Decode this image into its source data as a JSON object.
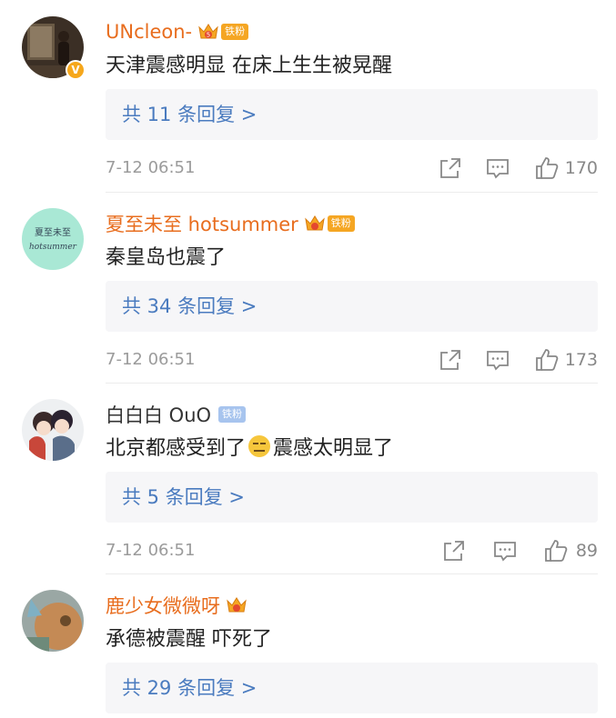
{
  "comments": [
    {
      "username": "UNcleon-",
      "crown_level": "5",
      "fan_badge": "铁粉",
      "verified_badge": "V",
      "text": "天津震感明显 在床上生生被晃醒",
      "replies": "共 11 条回复 >",
      "time": "7-12 06:51",
      "likes": "170",
      "name_color": "#e86d1e"
    },
    {
      "username": "夏至未至 hotsummer",
      "crown_level": "",
      "fan_badge": "铁粉",
      "avatar_text_1": "夏至未至",
      "avatar_text_2": "hotsummer",
      "text": "秦皇岛也震了",
      "replies": "共 34 条回复 >",
      "time": "7-12 06:51",
      "likes": "173",
      "name_color": "#e86d1e"
    },
    {
      "username": "白白白 OuO",
      "fan_badge": "铁粉",
      "text_before": "北京都感受到了",
      "emoji": "expressionless-face",
      "text_after": "震感太明显了",
      "replies": "共 5 条回复 >",
      "time": "7-12 06:51",
      "likes": "89",
      "name_color": "#333333"
    },
    {
      "username": "鹿少女微微呀",
      "text": "承德被震醒  吓死了",
      "replies": "共 29 条回复 >",
      "name_color": "#e86d1e"
    }
  ],
  "colors": {
    "accent_link": "#4a7bbf",
    "username_orange": "#e86d1e",
    "fan_badge_orange": "#f5a623",
    "fan_badge_blue": "#a7c4ee"
  },
  "icons": [
    "share-icon",
    "comment-icon",
    "like-icon",
    "crown-icon",
    "verified-v-icon"
  ]
}
